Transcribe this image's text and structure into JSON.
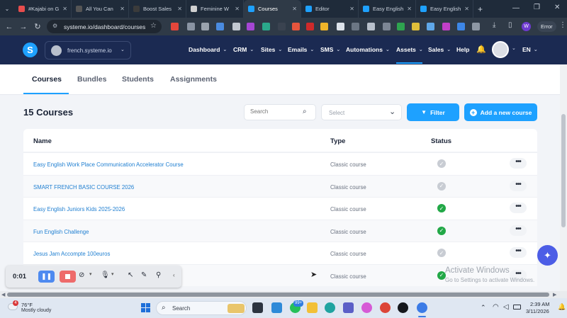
{
  "browser": {
    "tabs": [
      {
        "title": "#Kajabi on G",
        "fav_color": "#e74d4d"
      },
      {
        "title": "All You Can",
        "fav_color": "#555555"
      },
      {
        "title": "Boost Sales",
        "fav_color": "#3b3b3b"
      },
      {
        "title": "Feminine W",
        "fav_color": "#d0d0d0"
      },
      {
        "title": "Courses",
        "fav_color": "#1ea1ff"
      },
      {
        "title": "Editor",
        "fav_color": "#1ea1ff"
      },
      {
        "title": "Easy English",
        "fav_color": "#1ea1ff"
      },
      {
        "title": "Easy English",
        "fav_color": "#1ea1ff"
      }
    ],
    "url": "systeme.io/dashboard/courses",
    "error_label": "Error",
    "profile_initial": "W"
  },
  "app": {
    "logo": "S",
    "workspace": "french.systeme.io",
    "nav": [
      "Dashboard",
      "CRM",
      "Sites",
      "Emails",
      "SMS",
      "Automations",
      "Assets",
      "Sales"
    ],
    "help": "Help",
    "language": "EN"
  },
  "subtabs": [
    "Courses",
    "Bundles",
    "Students",
    "Assignments"
  ],
  "page": {
    "heading": "15 Courses",
    "search_placeholder": "Search",
    "select_placeholder": "Select",
    "filter_label": "Filter",
    "add_label": "Add a new course"
  },
  "table": {
    "headers": [
      "Name",
      "Type",
      "Status"
    ],
    "rows": [
      {
        "name": "Easy English Work Place Communication Accelerator Course",
        "type": "Classic course",
        "status": "unpublished"
      },
      {
        "name": "SMART FRENCH BASIC COURSE 2026",
        "type": "Classic course",
        "status": "unpublished"
      },
      {
        "name": "Easy English Juniors Kids 2025-2026",
        "type": "Classic course",
        "status": "published"
      },
      {
        "name": "Fun English Challenge",
        "type": "Classic course",
        "status": "published"
      },
      {
        "name": "Jesus Jam Accompte 100euros",
        "type": "Classic course",
        "status": "unpublished"
      },
      {
        "name": "",
        "type": "Classic course",
        "status": "published"
      }
    ],
    "more_label": "•••"
  },
  "recorder": {
    "time": "0:01"
  },
  "overlay": {
    "watermark_title": "Activate Windows",
    "watermark_sub": "Go to Settings to activate Windows."
  },
  "taskbar": {
    "weather_temp": "76°F",
    "weather_desc": "Mostly cloudy",
    "weather_badge": "4",
    "search_label": "Search",
    "time": "2:39 AM",
    "date": "3/11/2026",
    "whatsapp_badge": "99+"
  }
}
